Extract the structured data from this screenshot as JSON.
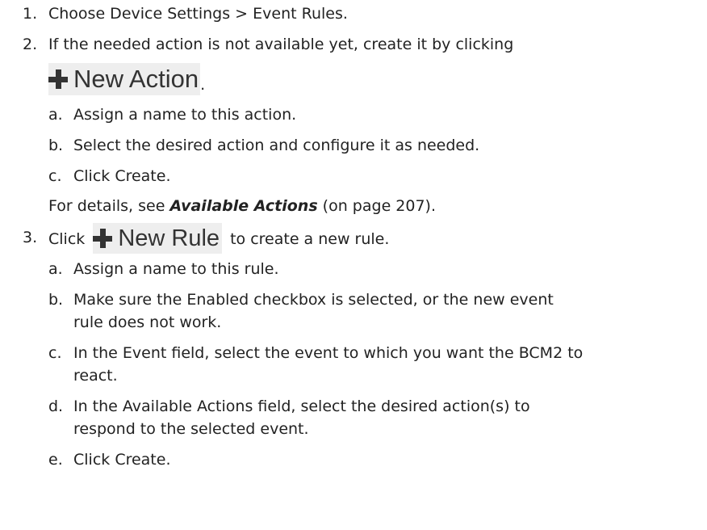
{
  "steps": [
    {
      "num": "1.",
      "text": "Choose Device Settings > Event Rules."
    },
    {
      "num": "2.",
      "text": "If the needed action is not available yet, create it by clicking",
      "button_label": "New Action",
      "after_button": ".",
      "substeps": [
        {
          "letter": "a.",
          "text": "Assign a name to this action."
        },
        {
          "letter": "b.",
          "text": "Select the desired action and configure it as needed."
        },
        {
          "letter": "c.",
          "text": "Click Create."
        }
      ],
      "note_prefix": "For details, see ",
      "note_link": "Available Actions",
      "note_suffix": " (on page 207)."
    },
    {
      "num": "3.",
      "text_before": "Click",
      "button_label": "New Rule",
      "text_after": "to create a new rule.",
      "substeps": [
        {
          "letter": "a.",
          "lines": [
            "Assign a name to this rule."
          ]
        },
        {
          "letter": "b.",
          "lines": [
            "Make sure the Enabled checkbox is selected, or the new event",
            "rule does not work."
          ]
        },
        {
          "letter": "c.",
          "lines": [
            "In the Event field, select the event to which you want the BCM2 to",
            "react."
          ]
        },
        {
          "letter": "d.",
          "lines": [
            "In the Available Actions field, select the desired action(s) to",
            "respond to the selected event."
          ]
        },
        {
          "letter": "e.",
          "lines": [
            "Click Create."
          ]
        }
      ]
    }
  ]
}
